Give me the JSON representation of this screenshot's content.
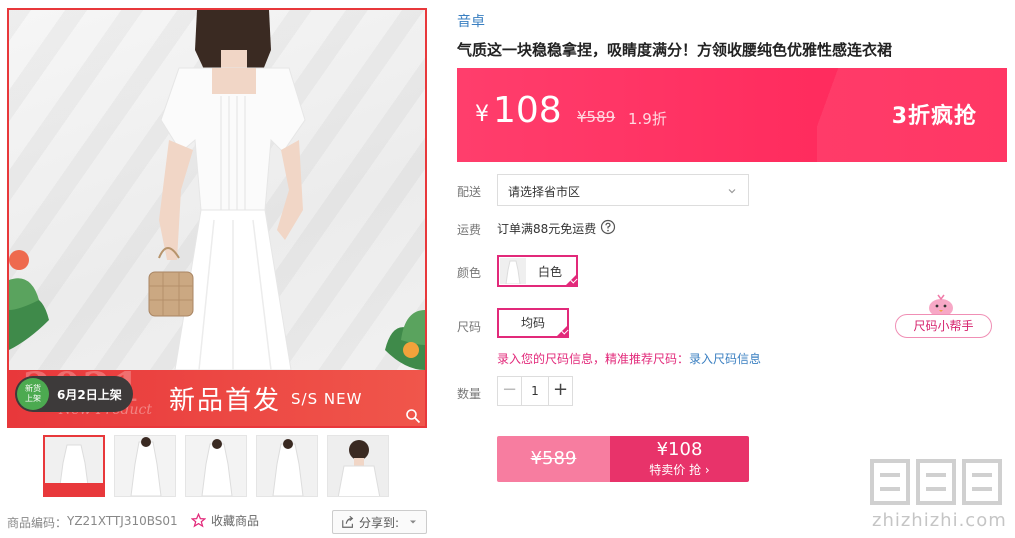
{
  "product": {
    "brand": "音卓",
    "title": "气质这一块稳稳拿捏，吸睛度满分！方领收腰纯色优雅性感连衣裙"
  },
  "gallery": {
    "banner_year": "2021",
    "banner_sub_en": "New Product",
    "launch_badge_line1": "新货",
    "launch_badge_line2": "上架",
    "launch_date": "6月2日上架",
    "banner_title": "新品首发",
    "banner_subtitle": "S/S NEW",
    "thumbnail_count": 5
  },
  "meta": {
    "code_label": "商品编码：",
    "code_value": "YZ21XTTJ310BS01",
    "favorite_label": "收藏商品",
    "share_label": "分享到:"
  },
  "price_box": {
    "currency": "¥",
    "price": "108",
    "original_price": "¥589",
    "discount": "1.9折",
    "promo": "3折疯抢"
  },
  "delivery": {
    "label": "配送",
    "placeholder": "请选择省市区"
  },
  "shipping": {
    "label": "运费",
    "text": "订单满88元免运费"
  },
  "color": {
    "label": "颜色",
    "selected": "白色"
  },
  "size": {
    "label": "尺码",
    "selected": "均码",
    "helper_button": "尺码小帮手",
    "tip_prefix": "录入您的尺码信息，精准推荐尺码：",
    "tip_link": "录入尺码信息"
  },
  "quantity": {
    "label": "数量",
    "value": "1",
    "minus": "−",
    "plus": "+"
  },
  "buy": {
    "original_price": "¥589",
    "price": "¥108",
    "label": "特卖价 抢 ›"
  },
  "watermark": {
    "text": "zhizhizhi.com"
  },
  "colors": {
    "accent_red": "#e8383b",
    "price_pink": "#ff2d5f",
    "select_magenta": "#e2297a",
    "link_blue": "#3a7fc1"
  }
}
